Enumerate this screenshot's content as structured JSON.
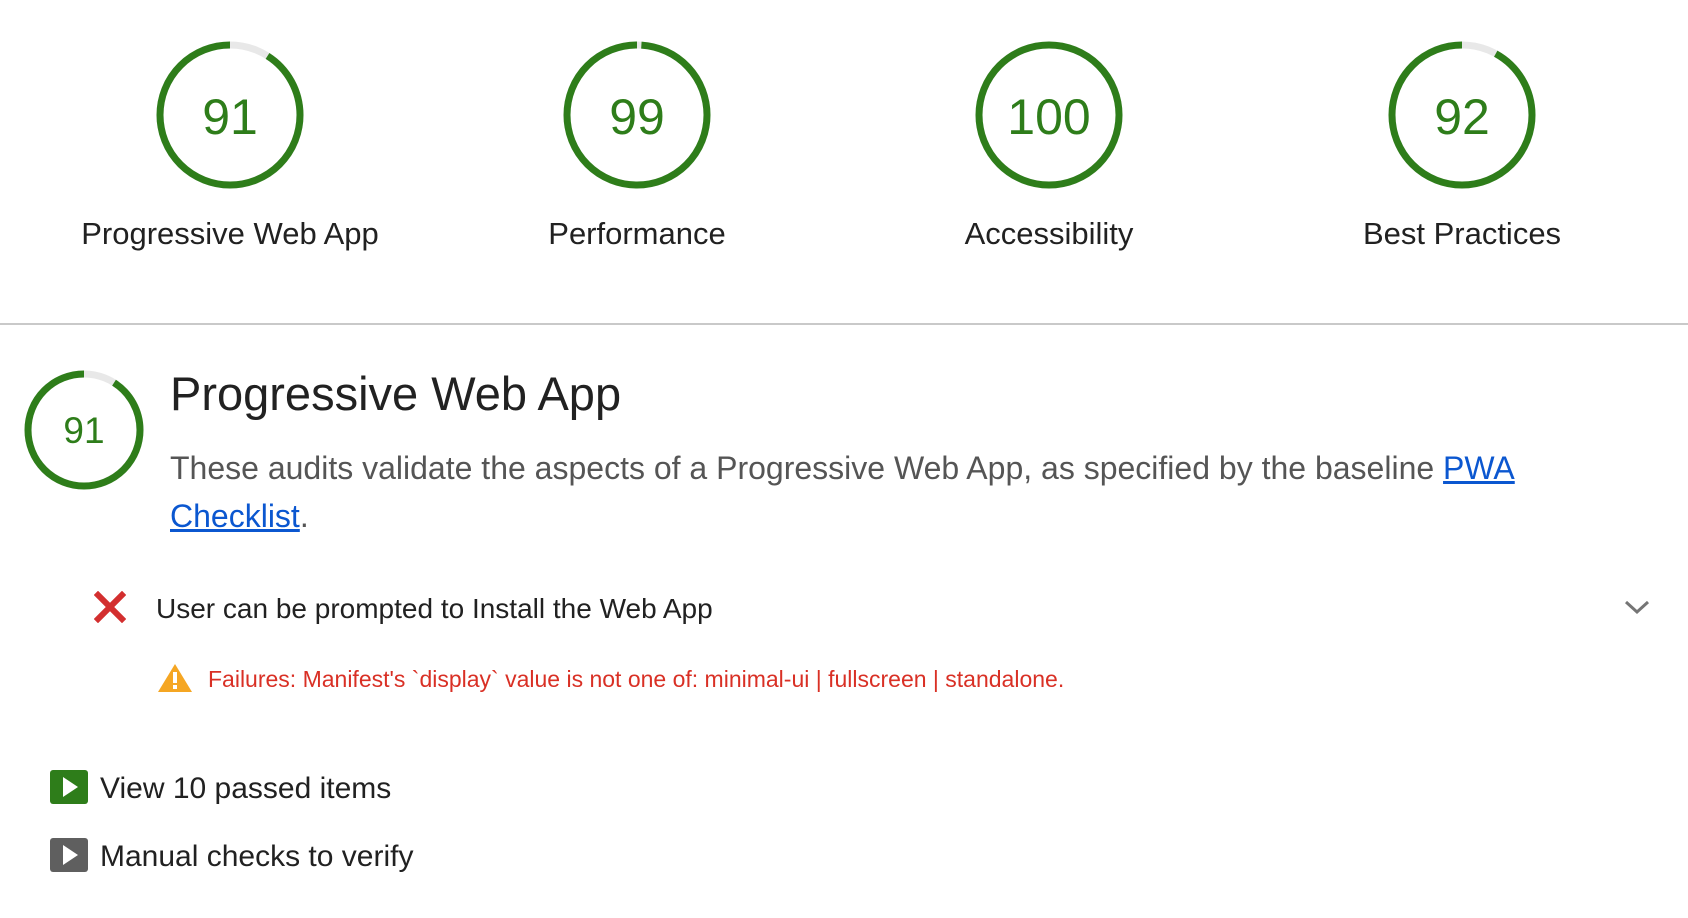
{
  "colors": {
    "pass": "#2e7d1a",
    "track": "#e8e8e8",
    "fail": "#d32f2f",
    "warning": "#f5a623",
    "link": "#0b57d0",
    "manual": "#5f5f5f"
  },
  "gauges": [
    {
      "score": "91",
      "score_value": 0.91,
      "label": "Progressive Web App"
    },
    {
      "score": "99",
      "score_value": 0.99,
      "label": "Performance"
    },
    {
      "score": "100",
      "score_value": 1.0,
      "label": "Accessibility"
    },
    {
      "score": "92",
      "score_value": 0.92,
      "label": "Best Practices"
    }
  ],
  "category": {
    "score": "91",
    "score_value": 0.91,
    "title": "Progressive Web App",
    "description_prefix": "These audits validate the aspects of a Progressive Web App, as specified by the baseline ",
    "link_text": "PWA Checklist",
    "description_suffix": "."
  },
  "audit": {
    "status_icon": "cross-icon",
    "title": "User can be prompted to Install the Web App",
    "expand_icon": "chevron-down-icon",
    "warning_icon": "warning-triangle-icon",
    "warning_text": "Failures: Manifest's `display` value is not one of: minimal-ui | fullscreen | standalone."
  },
  "groups": {
    "passed_label": "View 10 passed items",
    "manual_label": "Manual checks to verify"
  }
}
